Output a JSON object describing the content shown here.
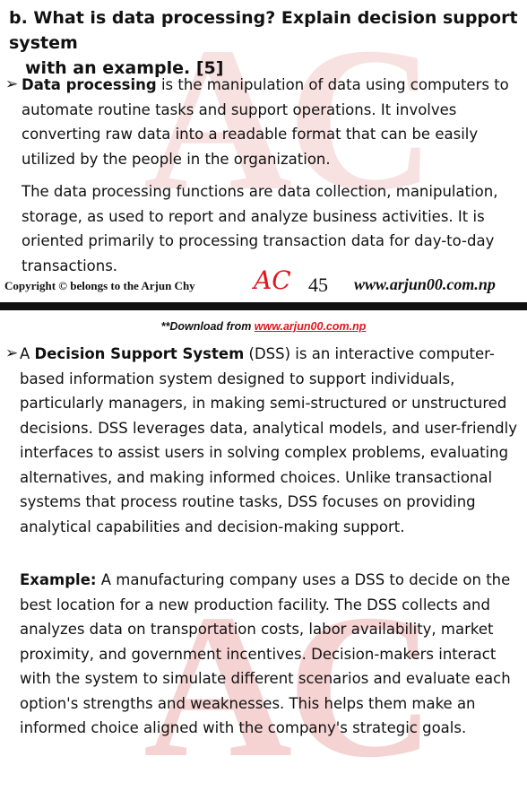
{
  "watermark": {
    "letters": "AC"
  },
  "question": {
    "line1": "b. What is data processing? Explain decision support system",
    "line2": "with an example. [5]"
  },
  "data_processing": {
    "term": "Data processing",
    "definition": " is the manipulation of data using computers to automate routine tasks and support operations. It involves converting raw data into a readable format that can be easily utilized by the people in the organization.",
    "functions": "The data processing functions are data collection, manipulation, storage, as used to report and analyze business activities. It is oriented primarily to processing transaction data for day-to-day transactions."
  },
  "footer": {
    "copyright": "Copyright © belongs  to the Arjun Chy",
    "logo": "AC",
    "page_number": "45",
    "website": "www.arjun00.com.np"
  },
  "download_banner": {
    "prefix": "**Download from ",
    "link": "www.arjun00.com.np"
  },
  "dss": {
    "intro": "A ",
    "term": "Decision Support System",
    "definition": " (DSS) is an interactive computer-based information system designed to support individuals, particularly managers, in making semi-structured or unstructured decisions. DSS leverages data, analytical models, and user-friendly interfaces to assist users in solving complex problems, evaluating alternatives, and making informed choices. Unlike transactional systems that process routine tasks, DSS focuses on providing analytical capabilities and decision-making support."
  },
  "example": {
    "label": "Example:",
    "text": " A manufacturing company uses a DSS to decide on the best location for a new production facility. The DSS collects and analyzes data on transportation costs, labor availability, market proximity, and government incentives. Decision-makers interact with the system to simulate different scenarios and evaluate each option's strengths and weaknesses. This helps them make an informed choice aligned with the company's strategic goals."
  }
}
